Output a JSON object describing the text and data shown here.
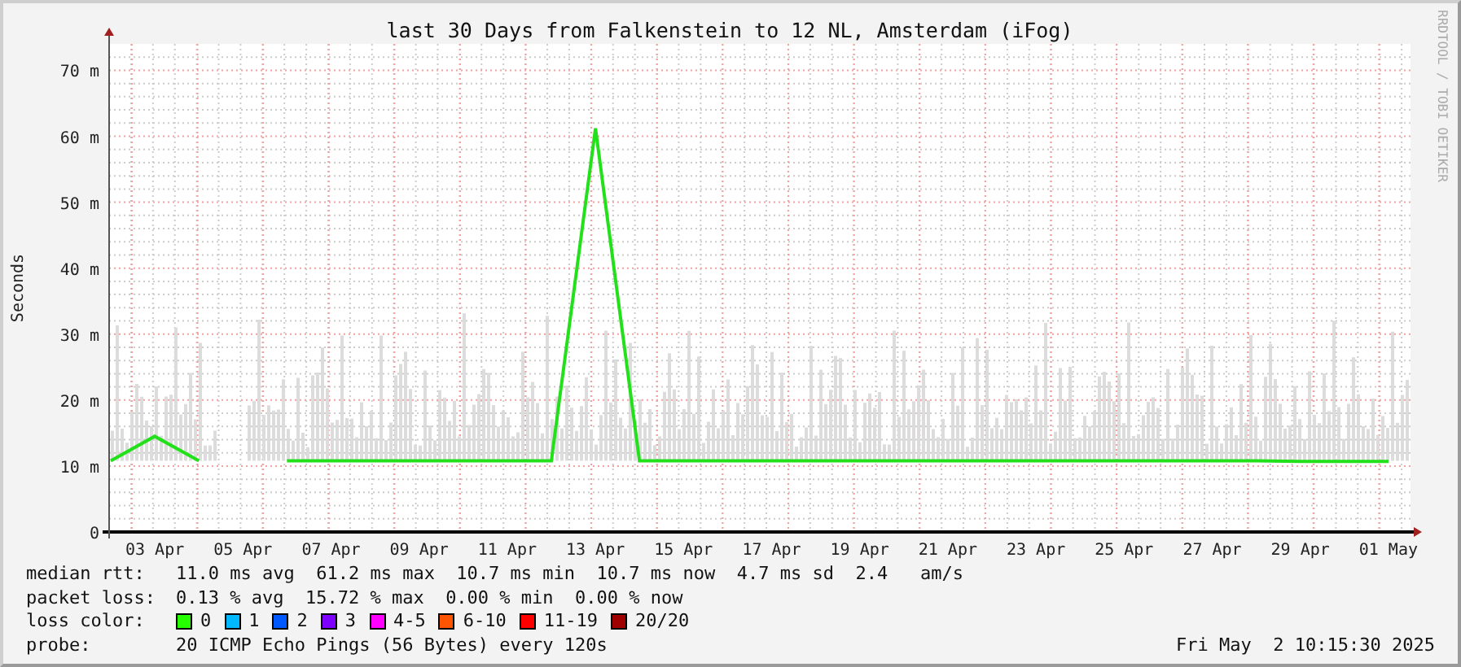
{
  "title": "last 30 Days from Falkenstein to 12 NL, Amsterdam (iFog)",
  "credit": "RRDTOOL / TOBI OETIKER",
  "chart_data": {
    "type": "line",
    "ylabel": "Seconds",
    "categories": [
      null,
      "03 Apr",
      null,
      "05 Apr",
      null,
      "07 Apr",
      null,
      "09 Apr",
      null,
      "11 Apr",
      null,
      "13 Apr",
      null,
      "15 Apr",
      null,
      "17 Apr",
      null,
      "19 Apr",
      null,
      "21 Apr",
      null,
      "23 Apr",
      null,
      "25 Apr",
      null,
      "27 Apr",
      null,
      "29 Apr",
      null,
      "01 May"
    ],
    "series": [
      {
        "color": "#22e01a",
        "values": [
          10.8,
          14.5,
          10.8,
          null,
          10.8,
          10.8,
          10.8,
          10.8,
          10.8,
          10.8,
          10.8,
          61.2,
          10.8,
          10.8,
          10.8,
          10.8,
          10.8,
          10.8,
          10.8,
          10.8,
          10.8,
          10.8,
          10.8,
          10.8,
          10.8,
          10.8,
          10.8,
          10.7,
          10.7,
          10.7
        ]
      }
    ],
    "ylim": [
      0,
      74
    ],
    "grid": true,
    "yticks": [
      {
        "value": 0,
        "label": "0"
      },
      {
        "value": 10,
        "label": "10 m"
      },
      {
        "value": 20,
        "label": "20 m"
      },
      {
        "value": 30,
        "label": "30 m"
      },
      {
        "value": 40,
        "label": "40 m"
      },
      {
        "value": 50,
        "label": "50 m"
      },
      {
        "value": 60,
        "label": "60 m"
      },
      {
        "value": 70,
        "label": "70 m"
      }
    ]
  },
  "stats": [
    {
      "label": "median rtt:",
      "text": "11.0 ms avg  61.2 ms max  10.7 ms min  10.7 ms now  4.7 ms sd  2.4   am/s"
    },
    {
      "label": "packet loss:",
      "text": "0.13 % avg  15.72 % max  0.00 % min  0.00 % now"
    }
  ],
  "loss_legend": {
    "label": "loss color:",
    "items": [
      {
        "label": "0",
        "color": "#26ff00"
      },
      {
        "label": "1",
        "color": "#00b8ff"
      },
      {
        "label": "2",
        "color": "#0059ff"
      },
      {
        "label": "3",
        "color": "#7e00ff"
      },
      {
        "label": "4-5",
        "color": "#ff00ff"
      },
      {
        "label": "6-10",
        "color": "#ff5500"
      },
      {
        "label": "11-19",
        "color": "#ff0000"
      },
      {
        "label": "20/20",
        "color": "#a10000"
      }
    ]
  },
  "probe": {
    "label": "probe:",
    "text": "20 ICMP Echo Pings (56 Bytes) every 120s"
  },
  "timestamp": "Fri May  2 10:15:30 2025"
}
